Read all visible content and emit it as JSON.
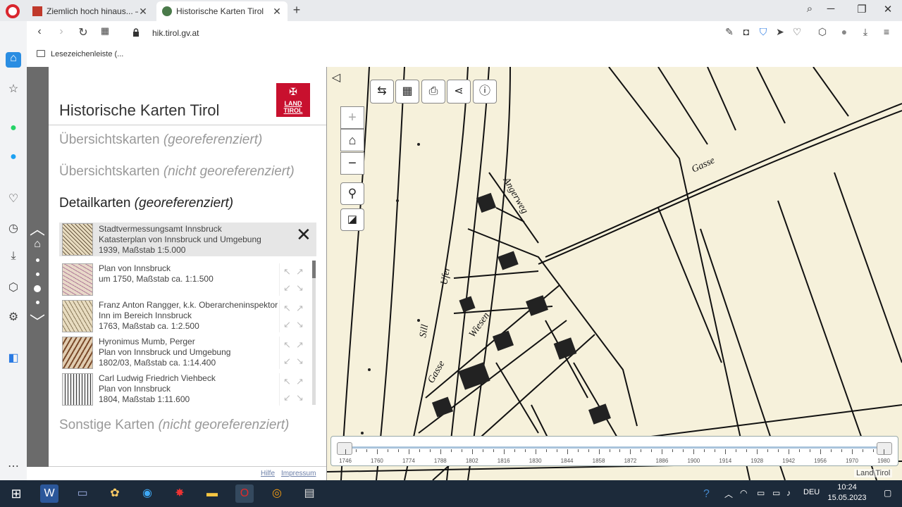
{
  "browser": {
    "tabs": [
      {
        "label": "Ziemlich hoch hinaus... – In"
      },
      {
        "label": "Historische Karten Tirol"
      }
    ],
    "url": "hik.tirol.gv.at",
    "bookmark": "Lesezeichenleiste (..."
  },
  "app": {
    "title": "Historische Karten Tirol",
    "logo_line1": "LAND",
    "logo_line2": "TIROL",
    "sections": [
      {
        "main": "Übersichtskarten",
        "sub": "(georeferenziert)"
      },
      {
        "main": "Übersichtskarten",
        "sub": "(nicht georeferenziert)"
      },
      {
        "main": "Detailkarten",
        "sub": "(georeferenziert)"
      },
      {
        "main": "Sonstige Karten",
        "sub": "(nicht georeferenziert)"
      }
    ],
    "selected": {
      "line1": "Stadtvermessungsamt Innsbruck",
      "line2": "Katasterplan von Innsbruck und Umgebung",
      "line3": "1939, Maßstab 1:5.000"
    },
    "items": [
      {
        "line1": "Plan von Innsbruck",
        "line2": "um 1750, Maßstab ca. 1:1.500",
        "line3": ""
      },
      {
        "line1": "Franz Anton Rangger, k.k. Oberarcheninspektor",
        "line2": "Inn im Bereich Innsbruck",
        "line3": "1763, Maßstab ca. 1:2.500"
      },
      {
        "line1": "Hyronimus Mumb, Perger",
        "line2": "Plan von Innsbruck und Umgebung",
        "line3": "1802/03, Maßstab ca. 1:14.400"
      },
      {
        "line1": "Carl Ludwig Friedrich Viehbeck",
        "line2": "Plan von Innsbruck",
        "line3": "1804, Maßstab 1:11.600"
      }
    ],
    "footer": {
      "help": "Hilfe",
      "imprint": "Impressum"
    },
    "credit": "Land Tirol",
    "timeline": {
      "years": [
        "1746",
        "1760",
        "1774",
        "1788",
        "1802",
        "1816",
        "1830",
        "1844",
        "1858",
        "1872",
        "1886",
        "1900",
        "1914",
        "1928",
        "1942",
        "1956",
        "1970",
        "1980"
      ],
      "start": "1746",
      "end": "1980"
    }
  },
  "map_labels": [
    "Sill",
    "Ufer",
    "Gasse",
    "Wiesen",
    "Gasse",
    "Angerweg"
  ],
  "taskbar": {
    "lang": "DEU",
    "time": "10:24",
    "date": "15.05.2023"
  }
}
